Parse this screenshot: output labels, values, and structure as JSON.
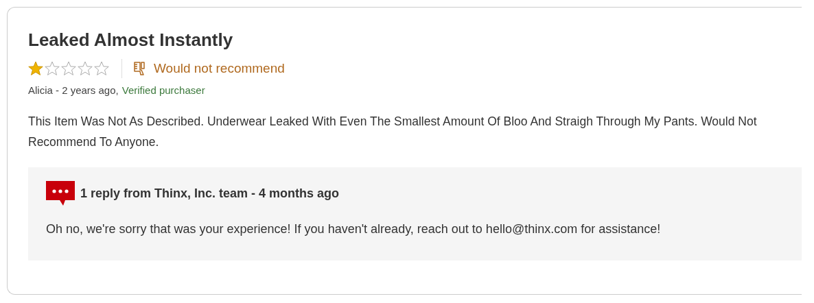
{
  "review": {
    "title": "Leaked Almost Instantly",
    "stars": 1,
    "recommendation": "Would not recommend",
    "author": "Alicia - 2 years ago,",
    "verified": "Verified purchaser",
    "body": "This Item Was Not As Described. Underwear Leaked With Even The Smallest Amount Of Bloo And Straigh Through My Pants. Would Not Recommend To Anyone.",
    "reply": {
      "heading": "1 reply from Thinx, Inc. team - 4 months ago",
      "text": "Oh no, we're sorry that was your experience! If you haven't already, reach out to hello@thinx.com for assistance!"
    }
  }
}
